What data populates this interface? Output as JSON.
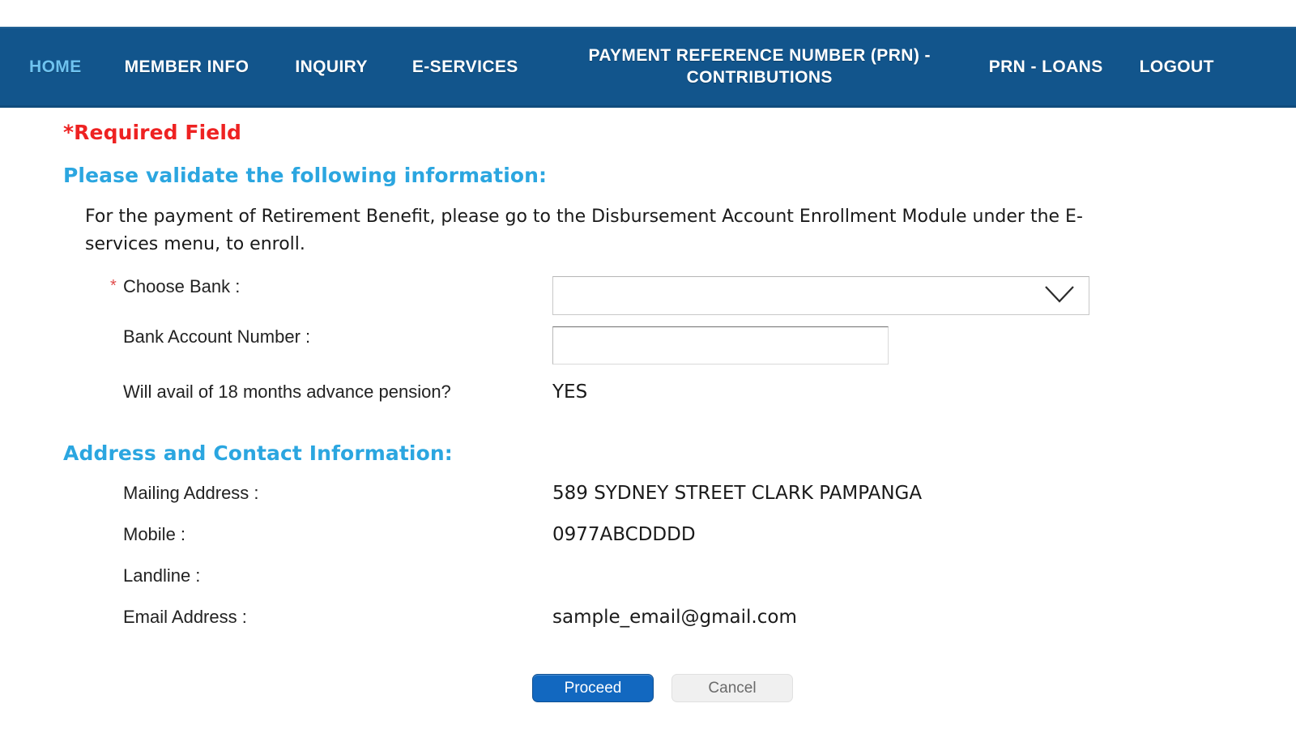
{
  "nav": {
    "items": [
      {
        "label": "HOME",
        "active": true
      },
      {
        "label": "MEMBER INFO",
        "active": false
      },
      {
        "label": "INQUIRY",
        "active": false
      },
      {
        "label": "E-SERVICES",
        "active": false
      },
      {
        "label": "PAYMENT REFERENCE NUMBER (PRN) - CONTRIBUTIONS",
        "active": false
      },
      {
        "label": "PRN - LOANS",
        "active": false
      },
      {
        "label": "LOGOUT",
        "active": false
      }
    ],
    "accent_active_color": "#6fc3f0",
    "background_color": "#12558c"
  },
  "main": {
    "required_note": "*Required Field",
    "validate_heading": "Please validate the following information:",
    "intro_paragraph": "For the payment of Retirement Benefit, please go to the Disbursement Account Enrollment Module under the E-services menu, to enroll.",
    "required_note_color": "#ee2222",
    "heading_color": "#2ba6e0",
    "fields": {
      "choose_bank": {
        "label": "Choose Bank :",
        "required_marker": "*",
        "value": "",
        "placeholder": ""
      },
      "bank_account_number": {
        "label": "Bank Account Number :",
        "value": "",
        "placeholder": ""
      },
      "advance_pension": {
        "label": "Will avail of 18 months advance pension?",
        "value": "YES"
      }
    },
    "address_heading": "Address and Contact Information:",
    "contact": [
      {
        "label": "Mailing Address :",
        "value": "589 SYDNEY STREET CLARK PAMPANGA"
      },
      {
        "label": "Mobile :",
        "value": "0977ABCDDDD"
      },
      {
        "label": "Landline :",
        "value": ""
      },
      {
        "label": "Email Address :",
        "value": "sample_email@gmail.com"
      }
    ],
    "buttons": {
      "proceed": "Proceed",
      "cancel": "Cancel",
      "proceed_color": "#1268c0",
      "cancel_color": "#f0f0f0"
    }
  },
  "icons": {
    "chevron_down": "chevron-down-icon"
  }
}
